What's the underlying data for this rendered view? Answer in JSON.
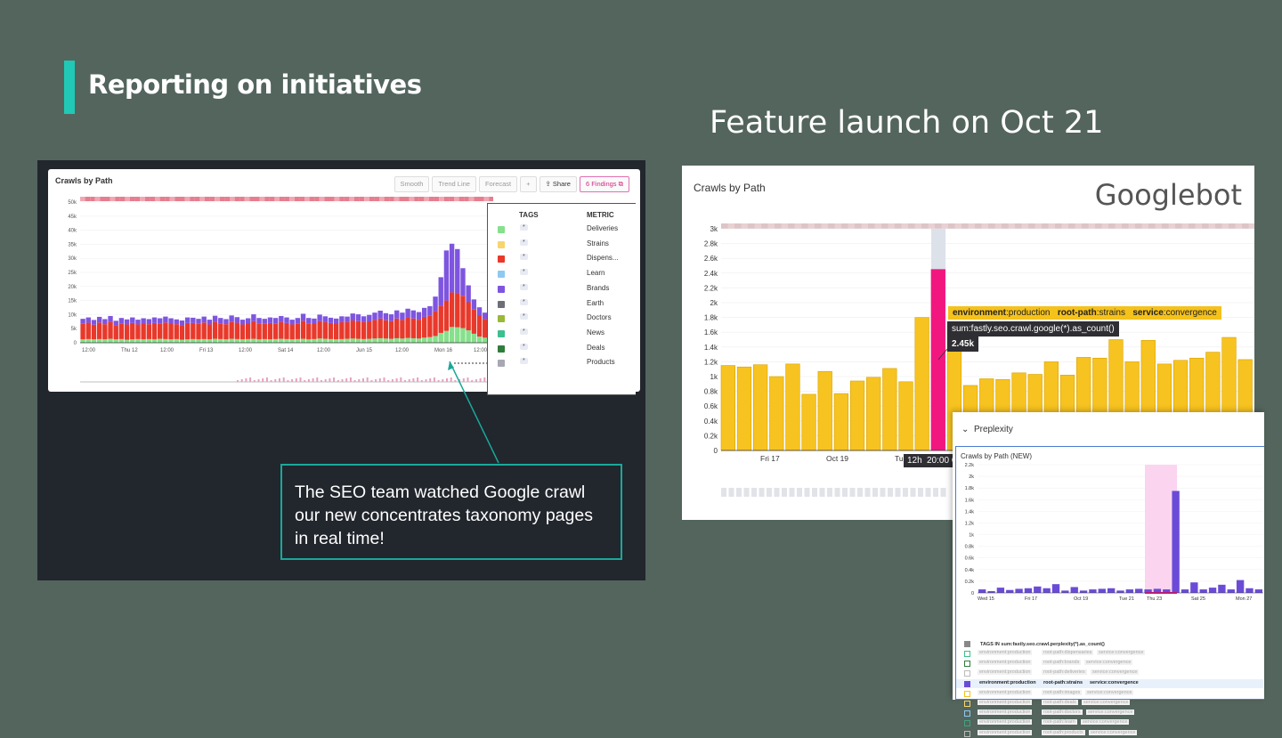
{
  "slide": {
    "title": "Reporting on initiatives",
    "subtitle": "Feature launch on Oct 21"
  },
  "left_panel": {
    "widget_title": "Crawls by Path",
    "toolbar": {
      "smooth": "Smooth",
      "trend_line": "Trend Line",
      "forecast": "Forecast",
      "add": "+",
      "share": "Share",
      "findings": "6 Findings"
    },
    "y_ticks": [
      "50k",
      "45k",
      "40k",
      "35k",
      "30k",
      "25k",
      "20k",
      "15k",
      "10k",
      "5k",
      "0"
    ],
    "x_ticks": [
      "12:00",
      "Thu 12",
      "12:00",
      "Fri 13",
      "12:00",
      "Sat 14",
      "12:00",
      "Jun 15",
      "12:00",
      "Mon 16",
      "12:00"
    ],
    "legend": {
      "tags_header": "TAGS",
      "metric_header": "METRIC",
      "items": [
        {
          "tag": "*",
          "name": "Deliveries",
          "color": "#86e08c"
        },
        {
          "tag": "*",
          "name": "Strains",
          "color": "#f7d56e"
        },
        {
          "tag": "*",
          "name": "Dispens...",
          "color": "#e8392b"
        },
        {
          "tag": "*",
          "name": "Learn",
          "color": "#8ec9f2"
        },
        {
          "tag": "*",
          "name": "Brands",
          "color": "#7e55e0"
        },
        {
          "tag": "*",
          "name": "Earth",
          "color": "#6c6f78"
        },
        {
          "tag": "*",
          "name": "Doctors",
          "color": "#9ab83a"
        },
        {
          "tag": "*",
          "name": "News",
          "color": "#3fbf8e"
        },
        {
          "tag": "*",
          "name": "Deals",
          "color": "#2f7d3b"
        },
        {
          "tag": "*",
          "name": "Products",
          "color": "#a8a8b3"
        }
      ]
    },
    "callout": "The SEO team watched Google crawl our new concentrates taxonomy pages in real time!"
  },
  "right_panel": {
    "widget_title": "Crawls by Path",
    "label": "Googlebot",
    "tooltip_tags": [
      {
        "key": "environment",
        "value": "production"
      },
      {
        "key": "root-path",
        "value": "strains"
      },
      {
        "key": "service",
        "value": "convergence"
      }
    ],
    "tooltip_metric": "sum:fastly.seo.crawl.google(*).as_count()",
    "tooltip_value": "2.45k",
    "time_tags": [
      "12h",
      "20:00 O"
    ]
  },
  "inset": {
    "section": "Preplexity",
    "widget_title": "Crawls by Path (NEW)",
    "tags_header": "TAGS IN sum:fastly.seo.crawl.perplexity(*).as_count()",
    "rows": [
      {
        "env": "environment:production",
        "path": "root-path:dispensaries",
        "service": "service:convergence",
        "active": false,
        "color": "#3fbf8e"
      },
      {
        "env": "environment:production",
        "path": "root-path:brands",
        "service": "service:convergence",
        "active": false,
        "color": "#2f7d3b"
      },
      {
        "env": "environment:production",
        "path": "root-path:deliveries",
        "service": "service:convergence",
        "active": false,
        "color": "#bbbbbb"
      },
      {
        "env": "environment:production",
        "path": "root-path:strains",
        "service": "service:convergence",
        "active": true,
        "color": "#6a4bd8"
      },
      {
        "env": "environment:production",
        "path": "root-path:images",
        "service": "service:convergence",
        "active": false,
        "color": "#f5c11b"
      },
      {
        "env": "environment:production",
        "path": "root-path:deals",
        "service": "service:convergence",
        "active": false,
        "color": "#f7d56e"
      },
      {
        "env": "environment:production",
        "path": "root-path:doctors",
        "service": "service:convergence",
        "active": false,
        "color": "#8ec9f2"
      },
      {
        "env": "environment:production",
        "path": "root-path:learn",
        "service": "service:convergence",
        "active": false,
        "color": "#3fa47e"
      },
      {
        "env": "environment:production",
        "path": "root-path:products",
        "service": "service:convergence",
        "active": false,
        "color": "#bbbbbb"
      }
    ]
  },
  "chart_data": [
    {
      "type": "bar",
      "title": "Crawls by Path",
      "stacked": true,
      "ylim": [
        0,
        50000
      ],
      "y_ticks": [
        "50k",
        "45k",
        "40k",
        "35k",
        "30k",
        "25k",
        "20k",
        "15k",
        "10k",
        "5k",
        "0"
      ],
      "x_ticks": [
        "12:00",
        "Thu 12",
        "12:00",
        "Fri 13",
        "12:00",
        "Sat 14",
        "12:00",
        "Jun 15",
        "12:00",
        "Mon 16",
        "12:00"
      ],
      "series": [
        {
          "name": "Deliveries",
          "color": "#86e08c",
          "values": [
            1200,
            1300,
            1200,
            1300,
            1200,
            1400,
            1200,
            1300,
            1100,
            1200,
            1300,
            1200,
            1300,
            1200,
            1400,
            1300,
            1200,
            1300,
            1100,
            1200,
            1300,
            1200,
            1300,
            1200,
            1400,
            1300,
            1200,
            1400,
            1300,
            1200,
            1300,
            1400,
            1200,
            1300,
            1200,
            1300,
            1400,
            1300,
            1200,
            1300,
            1400,
            1200,
            1300,
            1500,
            1400,
            1300,
            1200,
            1300,
            1400,
            1500,
            1400,
            1300,
            1400,
            1500,
            1600,
            1500,
            1400,
            1600,
            1500,
            1700,
            1600,
            1500,
            1800,
            2000,
            2400,
            3500,
            4200,
            5600,
            5500,
            5200,
            4400,
            3200,
            2200,
            1800,
            1400
          ]
        },
        {
          "name": "Dispens...",
          "color": "#e8392b",
          "values": [
            5500,
            5800,
            5200,
            5900,
            5400,
            6000,
            5000,
            5600,
            5400,
            5800,
            5200,
            5600,
            5300,
            5800,
            5500,
            5900,
            5600,
            5300,
            5200,
            5800,
            5700,
            5500,
            5900,
            5300,
            6000,
            5600,
            5400,
            6100,
            5800,
            5300,
            5500,
            6300,
            5700,
            5400,
            5800,
            5600,
            6000,
            5700,
            5300,
            5600,
            6400,
            5700,
            5500,
            6200,
            5900,
            5700,
            5600,
            6000,
            5900,
            6400,
            6300,
            6000,
            6200,
            6600,
            7000,
            6500,
            6300,
            7000,
            6600,
            7300,
            7000,
            6700,
            7400,
            7600,
            8800,
            9600,
            10800,
            12300,
            12200,
            11500,
            10000,
            8600,
            7600,
            6700,
            5800
          ]
        },
        {
          "name": "Brands",
          "color": "#7e55e0",
          "values": [
            1800,
            1900,
            1700,
            2000,
            1800,
            2100,
            1600,
            1900,
            1800,
            2000,
            1700,
            1900,
            1800,
            2000,
            1800,
            2100,
            1900,
            1700,
            1600,
            2000,
            1900,
            1800,
            2100,
            1700,
            2200,
            1900,
            1800,
            2200,
            2000,
            1700,
            1900,
            2400,
            1900,
            1800,
            2000,
            1900,
            2100,
            2000,
            1700,
            1900,
            2500,
            1900,
            1800,
            2300,
            2100,
            1900,
            1800,
            2100,
            2000,
            2500,
            2400,
            2100,
            2300,
            2600,
            2800,
            2500,
            2400,
            2900,
            2600,
            3100,
            2900,
            2700,
            3200,
            3400,
            5200,
            10200,
            17800,
            17300,
            15600,
            9800,
            6000,
            3600,
            2800,
            2200,
            1800
          ]
        }
      ]
    },
    {
      "type": "bar",
      "title": "Crawls by Path",
      "series_label": "Googlebot",
      "ylim": [
        0,
        3000
      ],
      "y_ticks": [
        "3k",
        "2.8k",
        "2.6k",
        "2.4k",
        "2.2k",
        "2k",
        "1.8k",
        "1.6k",
        "1.4k",
        "1.2k",
        "1k",
        "0.8k",
        "0.6k",
        "0.4k",
        "0.2k",
        "0"
      ],
      "x_ticks": [
        "Fri 17",
        "Oct 19",
        "Tue"
      ],
      "values": [
        1150,
        1130,
        1160,
        1000,
        1170,
        760,
        1070,
        770,
        940,
        990,
        1110,
        930,
        1800,
        2450,
        1700,
        880,
        970,
        960,
        1050,
        1030,
        1200,
        1020,
        1260,
        1250,
        1500,
        1200,
        1490,
        1170,
        1220,
        1250,
        1330,
        1530,
        1230
      ],
      "highlight_index": 13,
      "highlight_value": 2450
    },
    {
      "type": "bar",
      "title": "Crawls by Path (NEW)",
      "ylim": [
        0,
        2200
      ],
      "y_ticks": [
        "2.2k",
        "2k",
        "1.8k",
        "1.6k",
        "1.4k",
        "1.2k",
        "1k",
        "0.8k",
        "0.6k",
        "0.4k",
        "0.2k",
        "0"
      ],
      "x_ticks": [
        "Wed 15",
        "Fri 17",
        "Oct 19",
        "Tue 21",
        "Thu 23",
        "Sat 25",
        "Mon 27"
      ],
      "values": [
        60,
        30,
        90,
        50,
        70,
        80,
        110,
        80,
        150,
        40,
        100,
        40,
        60,
        70,
        80,
        40,
        60,
        70,
        60,
        70,
        60,
        1750,
        60,
        180,
        60,
        90,
        140,
        60,
        220,
        80,
        60
      ],
      "highlight_index": 21
    }
  ]
}
